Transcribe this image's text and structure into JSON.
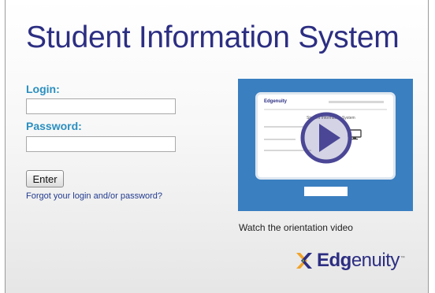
{
  "page": {
    "title": "Student Information System"
  },
  "login_form": {
    "login_label": "Login:",
    "login_value": "",
    "password_label": "Password:",
    "password_value": "",
    "enter_label": "Enter",
    "forgot_link": "Forgot your login and/or password?"
  },
  "video": {
    "caption": "Watch the orientation video",
    "thumbnail_logo": "Edgenuity",
    "thumbnail_title": "Student Information System",
    "icon": "play-icon"
  },
  "brand": {
    "name_bold": "Edg",
    "name_rest": "enuity",
    "trademark": "™",
    "icon": "edgenuity-x-logo-icon"
  },
  "colors": {
    "title": "#2c2e82",
    "labels": "#2a8fc0",
    "video_bg": "#3a7fc0",
    "link": "#223b8f"
  }
}
